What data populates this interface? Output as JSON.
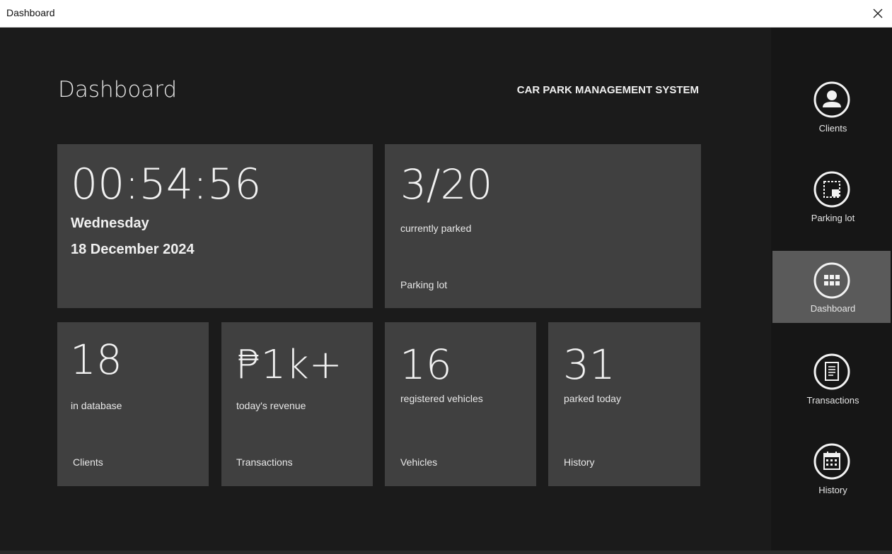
{
  "window": {
    "title": "Dashboard"
  },
  "header": {
    "page_title": "Dashboard",
    "system_name": "CAR PARK MANAGEMENT SYSTEM"
  },
  "tiles": {
    "clock": {
      "time": "00:54:56",
      "day": "Wednesday",
      "date": "18 December 2024"
    },
    "parking": {
      "value": "3/20",
      "sub": "currently parked",
      "label": "Parking lot"
    },
    "clients": {
      "value": "18",
      "sub": "in database",
      "label": "Clients"
    },
    "transactions": {
      "value": "₱1k+",
      "sub": "today's revenue",
      "label": "Transactions"
    },
    "vehicles": {
      "value": "16",
      "sub": "registered vehicles",
      "label": "Vehicles"
    },
    "history": {
      "value": "31",
      "sub": "parked today",
      "label": "History"
    }
  },
  "sidebar": {
    "items": [
      {
        "label": "Clients",
        "icon": "user-icon"
      },
      {
        "label": "Parking lot",
        "icon": "parking-lot-icon"
      },
      {
        "label": "Dashboard",
        "icon": "grid-icon",
        "active": true
      },
      {
        "label": "Transactions",
        "icon": "document-icon"
      },
      {
        "label": "History",
        "icon": "calendar-icon"
      }
    ]
  },
  "colors": {
    "background": "#1b1b1b",
    "tile": "#404040",
    "sidebar": "#161616",
    "active_nav": "#5a5a5a"
  }
}
